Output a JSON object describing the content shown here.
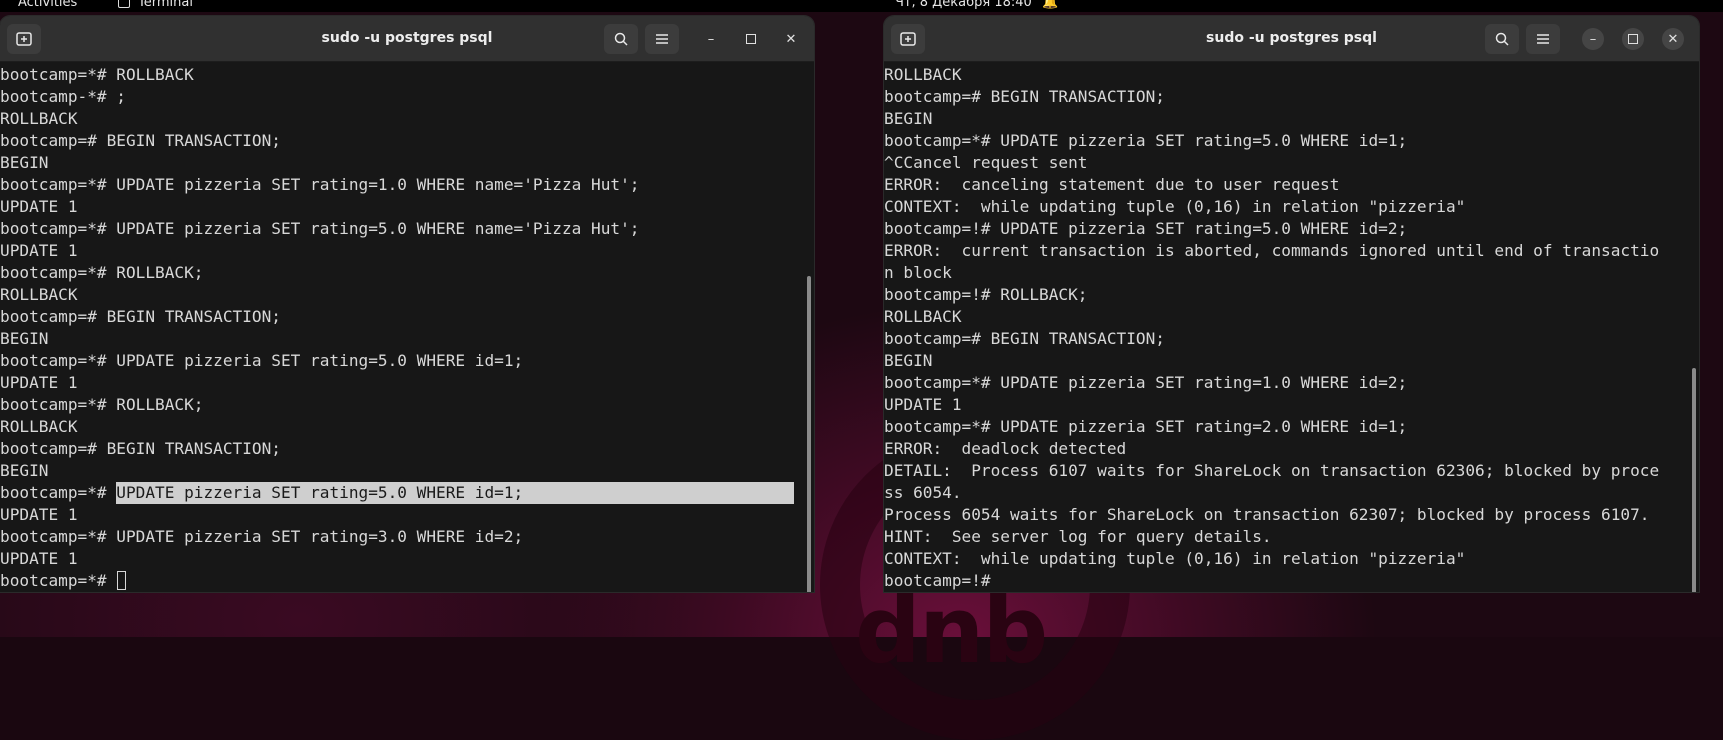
{
  "topbar": {
    "activities": "Activities",
    "app": "Terminal",
    "datetime": "Чт, 8 Декабря  18:40"
  },
  "wallpaper": {
    "logo_text": "dnb"
  },
  "left_window": {
    "title": "sudo -u postgres psql",
    "lines": [
      "bootcamp=*# ROLLBACK",
      "bootcamp-*# ;",
      "ROLLBACK",
      "bootcamp=# BEGIN TRANSACTION;",
      "BEGIN",
      "bootcamp=*# UPDATE pizzeria SET rating=1.0 WHERE name='Pizza Hut';",
      "UPDATE 1",
      "bootcamp=*# UPDATE pizzeria SET rating=5.0 WHERE name='Pizza Hut';",
      "UPDATE 1",
      "bootcamp=*# ROLLBACK;",
      "ROLLBACK",
      "bootcamp=# BEGIN TRANSACTION;",
      "BEGIN",
      "bootcamp=*# UPDATE pizzeria SET rating=5.0 WHERE id=1;",
      "UPDATE 1",
      "bootcamp=*# ROLLBACK;",
      "ROLLBACK",
      "bootcamp=# BEGIN TRANSACTION;",
      "BEGIN"
    ],
    "highlight_prompt": "bootcamp=*# ",
    "highlight_text": "UPDATE pizzeria SET rating=5.0 WHERE id=1;",
    "lines_after": [
      "UPDATE 1",
      "bootcamp=*# UPDATE pizzeria SET rating=3.0 WHERE id=2;",
      "UPDATE 1"
    ],
    "current_prompt": "bootcamp=*# "
  },
  "right_window": {
    "title": "sudo -u postgres psql",
    "lines": [
      "ROLLBACK",
      "bootcamp=# BEGIN TRANSACTION;",
      "BEGIN",
      "bootcamp=*# UPDATE pizzeria SET rating=5.0 WHERE id=1;",
      "^CCancel request sent",
      "ERROR:  canceling statement due to user request",
      "CONTEXT:  while updating tuple (0,16) in relation \"pizzeria\"",
      "bootcamp=!# UPDATE pizzeria SET rating=5.0 WHERE id=2;",
      "ERROR:  current transaction is aborted, commands ignored until end of transactio",
      "n block",
      "bootcamp=!# ROLLBACK;",
      "ROLLBACK",
      "bootcamp=# BEGIN TRANSACTION;",
      "BEGIN",
      "bootcamp=*# UPDATE pizzeria SET rating=1.0 WHERE id=2;",
      "UPDATE 1",
      "bootcamp=*# UPDATE pizzeria SET rating=2.0 WHERE id=1;",
      "ERROR:  deadlock detected",
      "DETAIL:  Process 6107 waits for ShareLock on transaction 62306; blocked by proce",
      "ss 6054.",
      "Process 6054 waits for ShareLock on transaction 62307; blocked by process 6107.",
      "HINT:  See server log for query details.",
      "CONTEXT:  while updating tuple (0,16) in relation \"pizzeria\"",
      "bootcamp=!# "
    ]
  }
}
